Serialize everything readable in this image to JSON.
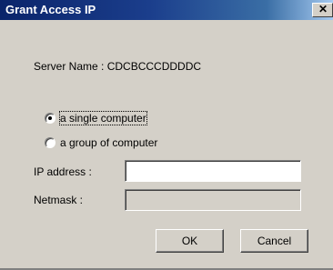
{
  "window": {
    "title": "Grant Access IP",
    "close_symbol": "✕",
    "close_icon": "close-icon"
  },
  "server": {
    "label_text": "Server Name : CDCBCCCDDDDC"
  },
  "radios": {
    "single": {
      "label": "a single computer",
      "checked": true
    },
    "group": {
      "label": "a group of computer",
      "checked": false
    }
  },
  "fields": {
    "ip_label": "IP address :",
    "ip_value": "",
    "netmask_label": "Netmask :",
    "netmask_value": ""
  },
  "buttons": {
    "ok": "OK",
    "cancel": "Cancel"
  },
  "colors": {
    "title_bar_start": "#0a246a",
    "title_bar_end": "#a6caf0",
    "dialog_bg": "#d4d0c8"
  }
}
